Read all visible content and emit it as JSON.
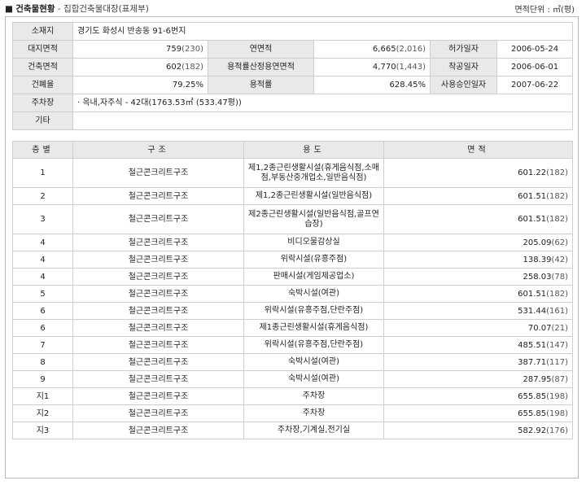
{
  "header": {
    "bullet": "■",
    "title": "건축물현황",
    "separator": "-",
    "subtitle": "집합건축물대장(표제부)",
    "unit": "면적단위 : ㎡(평)"
  },
  "summary": {
    "address_label": "소재지",
    "address": "경기도 화성시 반송동 91-6번지",
    "land_area_label": "대지면적",
    "land_area": "759",
    "land_area_pyeong": "(230)",
    "total_floor_area_label": "연면적",
    "total_floor_area": "6,665",
    "total_floor_area_pyeong": "(2,016)",
    "permit_date_label": "허가일자",
    "permit_date": "2006-05-24",
    "building_area_label": "건축면적",
    "building_area": "602",
    "building_area_pyeong": "(182)",
    "far_area_label": "용적률산정용연면적",
    "far_area": "4,770",
    "far_area_pyeong": "(1,443)",
    "start_date_label": "착공일자",
    "start_date": "2006-06-01",
    "bcr_label": "건폐율",
    "bcr": "79.25%",
    "far_label": "용적률",
    "far": "628.45%",
    "approval_date_label": "사용승인일자",
    "approval_date": "2007-06-22",
    "parking_label": "주차장",
    "parking": "· 옥내,자주식 - 42대(1763.53㎡ (533.47평))",
    "etc_label": "기타",
    "etc": ""
  },
  "floors": {
    "columns": [
      "층별",
      "구조",
      "용도",
      "면적"
    ],
    "rows": [
      {
        "floor": "1",
        "structure": "철근콘크리트구조",
        "use": "제1,2종근린생활시설(휴게음식점,소매점,부동산중개업소,일반음식점)",
        "area": "601.22",
        "pyeong": "(182)"
      },
      {
        "floor": "2",
        "structure": "철근콘크리트구조",
        "use": "제1,2종근린생활시설(일반음식점)",
        "area": "601.51",
        "pyeong": "(182)"
      },
      {
        "floor": "3",
        "structure": "철근콘크리트구조",
        "use": "제2종근린생활시설(일반음식점,골프연습장)",
        "area": "601.51",
        "pyeong": "(182)"
      },
      {
        "floor": "4",
        "structure": "철근콘크리트구조",
        "use": "비디오물감상실",
        "area": "205.09",
        "pyeong": "(62)"
      },
      {
        "floor": "4",
        "structure": "철근콘크리트구조",
        "use": "위락시설(유흥주점)",
        "area": "138.39",
        "pyeong": "(42)"
      },
      {
        "floor": "4",
        "structure": "철근콘크리트구조",
        "use": "판매시설(게임제공업소)",
        "area": "258.03",
        "pyeong": "(78)"
      },
      {
        "floor": "5",
        "structure": "철근콘크리트구조",
        "use": "숙박시설(여관)",
        "area": "601.51",
        "pyeong": "(182)"
      },
      {
        "floor": "6",
        "structure": "철근콘크리트구조",
        "use": "위락시설(유흥주점,단란주점)",
        "area": "531.44",
        "pyeong": "(161)"
      },
      {
        "floor": "6",
        "structure": "철근콘크리트구조",
        "use": "제1종근린생활시설(휴게음식점)",
        "area": "70.07",
        "pyeong": "(21)"
      },
      {
        "floor": "7",
        "structure": "철근콘크리트구조",
        "use": "위락시설(유흥주점,단란주점)",
        "area": "485.51",
        "pyeong": "(147)"
      },
      {
        "floor": "8",
        "structure": "철근콘크리트구조",
        "use": "숙박시설(여관)",
        "area": "387.71",
        "pyeong": "(117)"
      },
      {
        "floor": "9",
        "structure": "철근콘크리트구조",
        "use": "숙박시설(여관)",
        "area": "287.95",
        "pyeong": "(87)"
      },
      {
        "floor": "지1",
        "structure": "철근콘크리트구조",
        "use": "주차장",
        "area": "655.85",
        "pyeong": "(198)"
      },
      {
        "floor": "지2",
        "structure": "철근콘크리트구조",
        "use": "주차장",
        "area": "655.85",
        "pyeong": "(198)"
      },
      {
        "floor": "지3",
        "structure": "철근콘크리트구조",
        "use": "주차장,기계실,전기실",
        "area": "582.92",
        "pyeong": "(176)"
      }
    ]
  }
}
